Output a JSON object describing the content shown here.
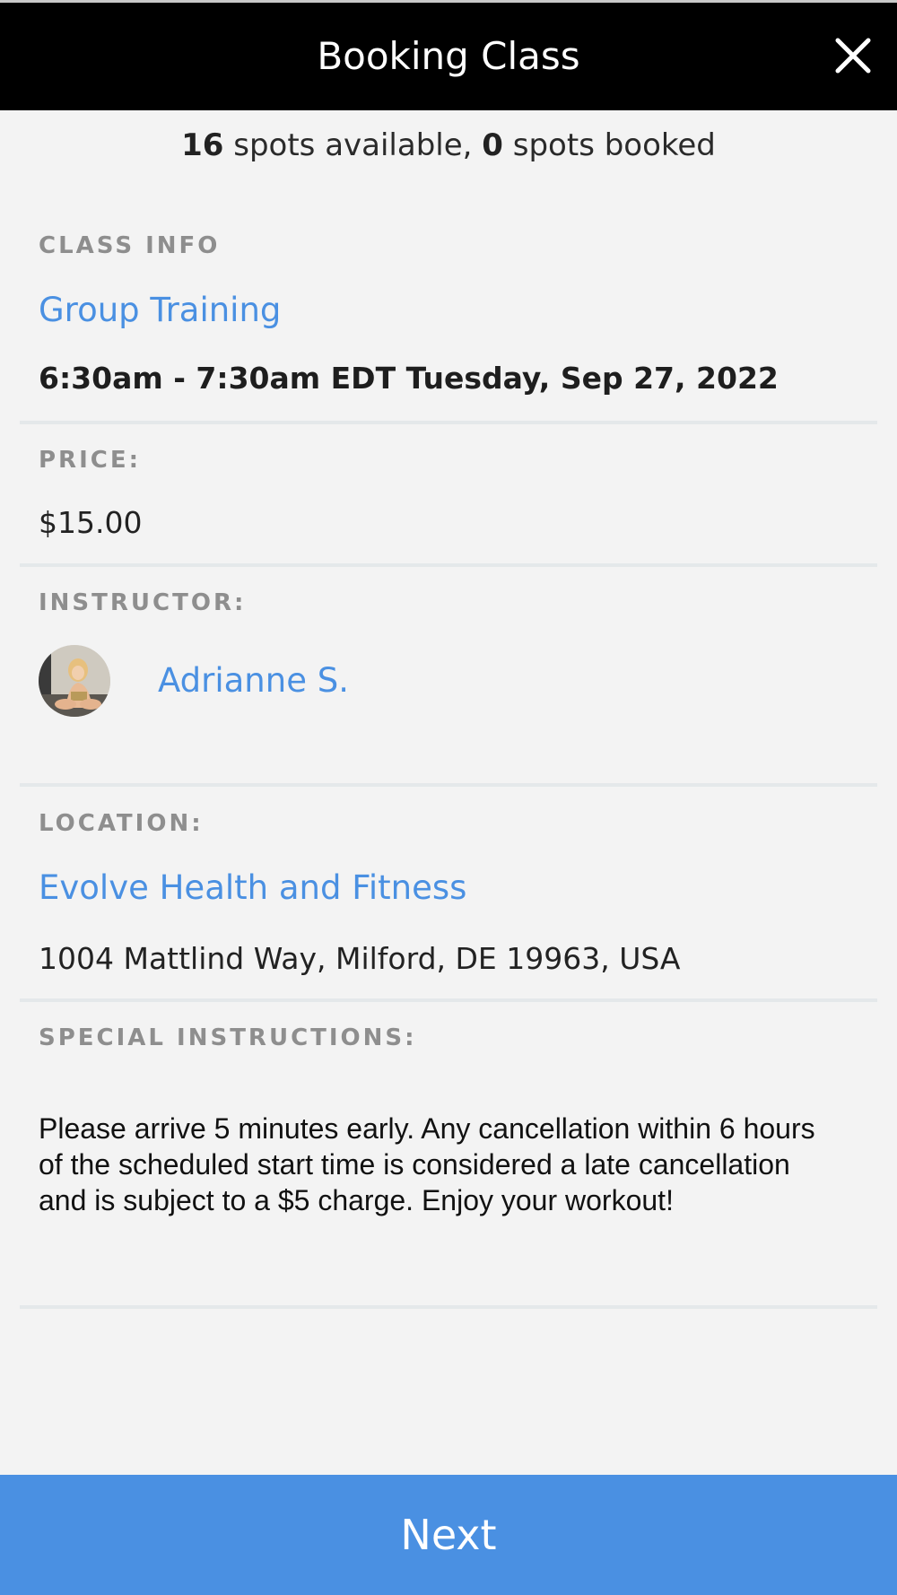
{
  "header": {
    "title": "Booking Class",
    "close_icon": "close-icon"
  },
  "availability": {
    "spots_available": "16",
    "spots_available_suffix": " spots available, ",
    "spots_booked": "0",
    "spots_booked_suffix": " spots booked"
  },
  "class_info": {
    "label": "CLASS INFO",
    "class_name": "Group Training",
    "datetime": "6:30am - 7:30am EDT Tuesday, Sep 27, 2022"
  },
  "price": {
    "label": "PRICE:",
    "value": "$15.00"
  },
  "instructor": {
    "label": "INSTRUCTOR:",
    "name": "Adrianne S."
  },
  "location": {
    "label": "LOCATION:",
    "name": "Evolve Health and Fitness",
    "address": "1004 Mattlind Way, Milford, DE 19963, USA"
  },
  "special_instructions": {
    "label": "SPECIAL INSTRUCTIONS:",
    "text": "Please arrive 5 minutes early.  Any cancellation within 6 hours of the scheduled start time is considered a late cancellation and is subject to a $5 charge.  Enjoy your workout!"
  },
  "footer": {
    "next_label": "Next"
  },
  "colors": {
    "accent": "#4a90e2",
    "header_bg": "#000000",
    "page_bg": "#f3f3f3",
    "label_gray": "#8e8e8e"
  }
}
